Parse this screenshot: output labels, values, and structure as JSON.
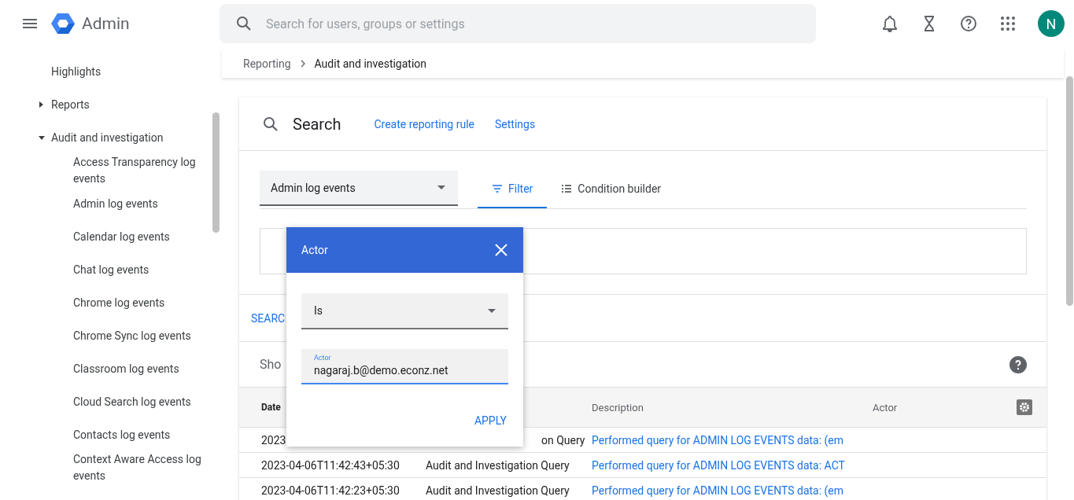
{
  "header": {
    "app_name": "Admin",
    "search_placeholder": "Search for users, groups or settings",
    "avatar": "N"
  },
  "breadcrumb": [
    "Reporting",
    "Audit and investigation"
  ],
  "sidebar": {
    "items": [
      {
        "label": "Highlights"
      },
      {
        "label": "Reports",
        "expanded": false
      },
      {
        "label": "Audit and investigation",
        "expanded": true,
        "children": [
          {
            "label": "Access Transparency log events"
          },
          {
            "label": "Admin log events"
          },
          {
            "label": "Calendar log events"
          },
          {
            "label": "Chat log events"
          },
          {
            "label": "Chrome log events"
          },
          {
            "label": "Chrome Sync log events"
          },
          {
            "label": "Classroom log events"
          },
          {
            "label": "Cloud Search log events"
          },
          {
            "label": "Contacts log events"
          },
          {
            "label": "Context Aware Access log events"
          }
        ]
      }
    ]
  },
  "search_card": {
    "title": "Search",
    "links": [
      "Create reporting rule",
      "Settings"
    ],
    "source_select": "Admin log events",
    "tabs": [
      {
        "label": "Filter",
        "selected": true
      },
      {
        "label": "Condition builder",
        "selected": false
      }
    ],
    "search_button": "SEARC",
    "show_text": "Sho",
    "table": {
      "columns": [
        "Date",
        "Description",
        "Actor"
      ],
      "rows": [
        {
          "date": "2023",
          "event": "on Query",
          "description": "Performed query for ADMIN LOG EVENTS data: (em"
        },
        {
          "date": "2023-04-06T11:42:43+05:30",
          "event": "Audit and Investigation Query",
          "description": "Performed query for ADMIN LOG EVENTS data: ACT"
        },
        {
          "date": "2023-04-06T11:42:23+05:30",
          "event": "Audit and Investigation Query",
          "description": "Performed query for ADMIN LOG EVENTS data: (em"
        }
      ]
    }
  },
  "popup": {
    "title": "Actor",
    "operator": "Is",
    "field_label": "Actor",
    "value": "nagaraj.b@demo.econz.net",
    "button": "APPLY"
  }
}
